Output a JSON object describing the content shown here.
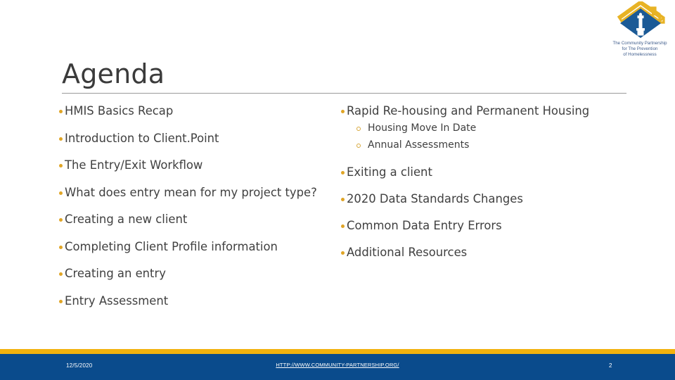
{
  "slide": {
    "title": "Agenda",
    "page_number": "2"
  },
  "logo": {
    "name": "community-partnership-logo",
    "caption_line1": "The Community Partnership",
    "caption_line2": "for The Prevention",
    "caption_line3": "of Homelessness",
    "diamond_color": "#1b5a96",
    "roof_color": "#e8b325",
    "column_color": "#ffffff",
    "caption_color": "#3c5a8a"
  },
  "left_column": {
    "items": [
      {
        "label": "HMIS Basics Recap"
      },
      {
        "label": "Introduction to Client.Point"
      },
      {
        "label": "The Entry/Exit Workflow"
      },
      {
        "label": "What does entry mean for my project type?"
      },
      {
        "label": "Creating a new client"
      },
      {
        "label": "Completing Client Profile information"
      },
      {
        "label": "Creating an entry"
      },
      {
        "label": "Entry Assessment"
      }
    ]
  },
  "right_column": {
    "items": [
      {
        "label": "Rapid Re-housing and Permanent Housing",
        "sub_items": [
          {
            "label": "Housing Move In Date"
          },
          {
            "label": "Annual Assessments"
          }
        ]
      },
      {
        "label": "Exiting a client",
        "sub_items": []
      },
      {
        "label": "2020 Data Standards Changes",
        "sub_items": []
      },
      {
        "label": "Common Data Entry Errors",
        "sub_items": []
      },
      {
        "label": "Additional Resources",
        "sub_items": []
      }
    ]
  },
  "footer": {
    "date": "12/5/2020",
    "link_text": "HTTP://WWW.COMMUNITY-PARTNERSHIP.ORG/",
    "page_number": "2",
    "accent_color": "#f2b20e",
    "bar_color": "#0a4b8c"
  },
  "theme": {
    "bullet_color": "#e0a526",
    "text_color": "#404040",
    "rule_color": "#9a9a9a"
  }
}
